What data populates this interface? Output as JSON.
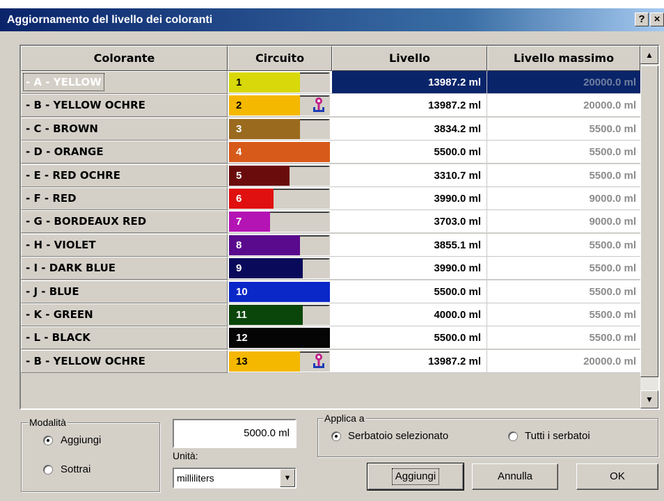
{
  "window": {
    "title": "Aggiornamento del livello dei coloranti",
    "help_label": "?",
    "close_label": "×"
  },
  "table": {
    "columns": [
      "Colorante",
      "Circuito",
      "Livello",
      "Livello massimo"
    ],
    "rows": [
      {
        "name": "- A - YELLOW",
        "circuit": "1",
        "color": "#d8d80a",
        "fill": 0.7,
        "text_color": "#000000",
        "level": "13987.2 ml",
        "max": "20000.0 ml",
        "pump": false,
        "selected": true
      },
      {
        "name": "- B - YELLOW OCHRE",
        "circuit": "2",
        "color": "#f5b800",
        "fill": 0.7,
        "text_color": "#000000",
        "level": "13987.2 ml",
        "max": "20000.0 ml",
        "pump": true,
        "selected": false
      },
      {
        "name": "- C - BROWN",
        "circuit": "3",
        "color": "#9a6a1e",
        "fill": 0.7,
        "text_color": "#ffffff",
        "level": "3834.2 ml",
        "max": "5500.0 ml",
        "pump": false,
        "selected": false
      },
      {
        "name": "- D - ORANGE",
        "circuit": "4",
        "color": "#d85a1a",
        "fill": 1.0,
        "text_color": "#ffffff",
        "level": "5500.0 ml",
        "max": "5500.0 ml",
        "pump": false,
        "selected": false
      },
      {
        "name": "- E - RED OCHRE",
        "circuit": "5",
        "color": "#6a0c0c",
        "fill": 0.6,
        "text_color": "#ffffff",
        "level": "3310.7 ml",
        "max": "5500.0 ml",
        "pump": false,
        "selected": false
      },
      {
        "name": "- F - RED",
        "circuit": "6",
        "color": "#e01010",
        "fill": 0.44,
        "text_color": "#ffffff",
        "level": "3990.0 ml",
        "max": "9000.0 ml",
        "pump": false,
        "selected": false
      },
      {
        "name": "- G - BORDEAUX RED",
        "circuit": "7",
        "color": "#b414b4",
        "fill": 0.41,
        "text_color": "#ffffff",
        "level": "3703.0 ml",
        "max": "9000.0 ml",
        "pump": false,
        "selected": false
      },
      {
        "name": "- H - VIOLET",
        "circuit": "8",
        "color": "#5a0a8c",
        "fill": 0.7,
        "text_color": "#ffffff",
        "level": "3855.1 ml",
        "max": "5500.0 ml",
        "pump": false,
        "selected": false
      },
      {
        "name": "- I - DARK BLUE",
        "circuit": "9",
        "color": "#0a0a5a",
        "fill": 0.73,
        "text_color": "#ffffff",
        "level": "3990.0 ml",
        "max": "5500.0 ml",
        "pump": false,
        "selected": false
      },
      {
        "name": "- J - BLUE",
        "circuit": "10",
        "color": "#0a28c8",
        "fill": 1.0,
        "text_color": "#ffffff",
        "level": "5500.0 ml",
        "max": "5500.0 ml",
        "pump": false,
        "selected": false
      },
      {
        "name": "- K - GREEN",
        "circuit": "11",
        "color": "#0a460a",
        "fill": 0.73,
        "text_color": "#ffffff",
        "level": "4000.0 ml",
        "max": "5500.0 ml",
        "pump": false,
        "selected": false
      },
      {
        "name": "- L - BLACK",
        "circuit": "12",
        "color": "#050505",
        "fill": 1.0,
        "text_color": "#ffffff",
        "level": "5500.0 ml",
        "max": "5500.0 ml",
        "pump": false,
        "selected": false
      },
      {
        "name": "- B - YELLOW OCHRE",
        "circuit": "13",
        "color": "#f5b800",
        "fill": 0.7,
        "text_color": "#000000",
        "level": "13987.2 ml",
        "max": "20000.0 ml",
        "pump": true,
        "selected": false
      }
    ]
  },
  "modalita": {
    "label": "Modalità",
    "options": [
      "Aggiungi",
      "Sottrai"
    ],
    "selected": 0
  },
  "amount": {
    "value": "5000.0 ml"
  },
  "unita": {
    "label": "Unità:",
    "value": "milliliters"
  },
  "applica": {
    "label": "Applica a",
    "options": [
      "Serbatoio selezionato",
      "Tutti i serbatoi"
    ],
    "selected": 0
  },
  "buttons": {
    "aggiungi": "Aggiungi",
    "annulla": "Annulla",
    "ok": "OK"
  },
  "icons": {
    "pump": "pump-icon",
    "scroll_up": "arrow-up-icon",
    "scroll_down": "arrow-down-icon",
    "dropdown": "chevron-down-icon"
  }
}
